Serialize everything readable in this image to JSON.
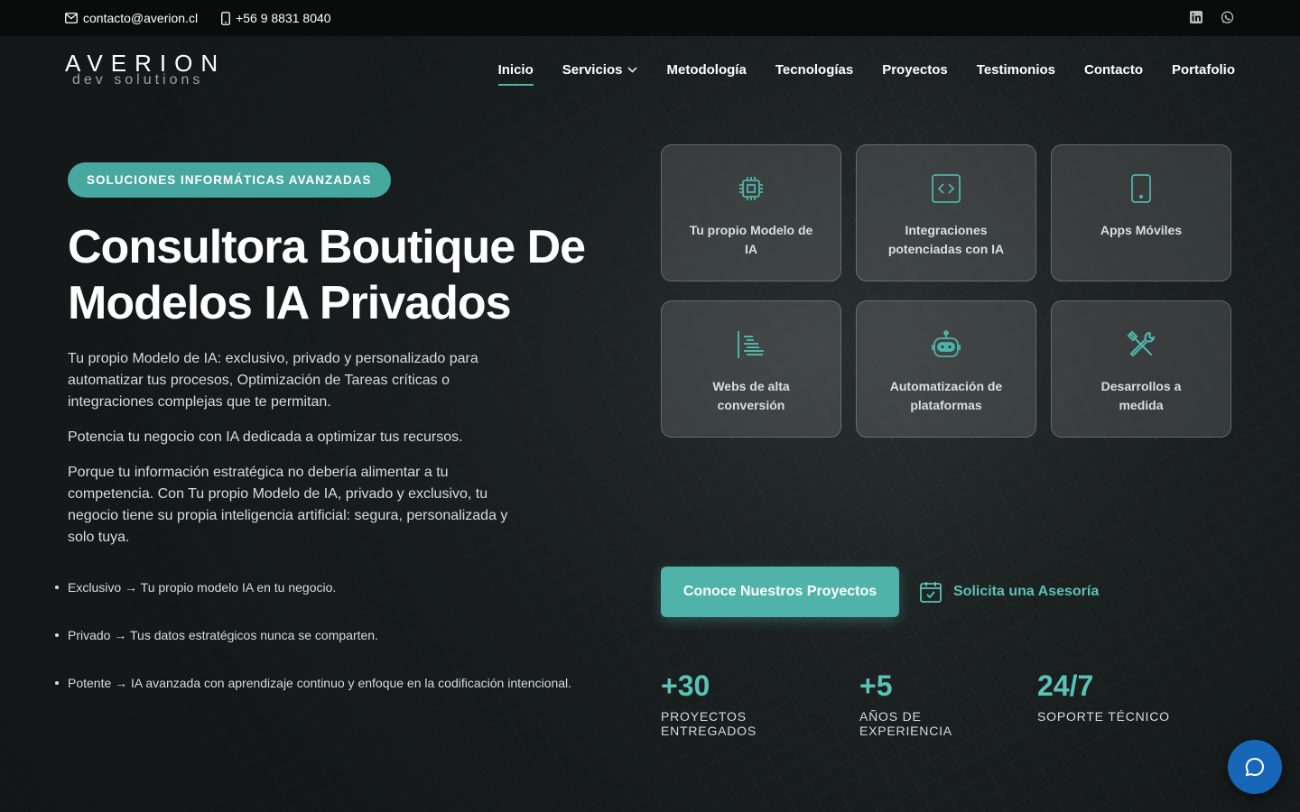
{
  "topbar": {
    "email": "contacto@averion.cl",
    "phone": "+56 9 8831 8040",
    "social": [
      "linkedin-icon",
      "whatsapp-icon"
    ]
  },
  "nav": {
    "logo_brand": "AVERION",
    "logo_sub": "dev solutions",
    "items": [
      {
        "label": "Inicio",
        "active": true
      },
      {
        "label": "Servicios",
        "dropdown": true
      },
      {
        "label": "Metodología"
      },
      {
        "label": "Tecnologías"
      },
      {
        "label": "Proyectos"
      },
      {
        "label": "Testimonios"
      },
      {
        "label": "Contacto"
      },
      {
        "label": "Portafolio"
      }
    ]
  },
  "hero": {
    "badge": "SOLUCIONES INFORMÁTICAS AVANZADAS",
    "headline": "Consultora Boutique De Modelos IA Privados",
    "paragraphs": [
      "Tu propio Modelo de IA: exclusivo, privado y personalizado para automatizar tus procesos, Optimización de Tareas críticas o integraciones complejas que te permitan.",
      "Potencia tu negocio con IA dedicada a optimizar tus recursos.",
      "Porque tu información estratégica no debería alimentar a tu competencia. Con Tu propio Modelo de IA, privado y exclusivo, tu negocio tiene su propia inteligencia artificial: segura, personalizada y solo tuya."
    ],
    "bullets": [
      "Exclusivo → Tu propio modelo IA en tu negocio.",
      "Privado → Tus datos estratégicos nunca se comparten.",
      "Potente → IA avanzada con aprendizaje continuo y enfoque en la codificación intencional."
    ]
  },
  "services": [
    {
      "label": "Tu propio Modelo de IA",
      "icon": "cpu-icon"
    },
    {
      "label": "Integraciones potenciadas con IA",
      "icon": "code-icon"
    },
    {
      "label": "Apps Móviles",
      "icon": "smartphone-icon"
    },
    {
      "label": "Webs de alta conversión",
      "icon": "list-icon"
    },
    {
      "label": "Automatización de plataformas",
      "icon": "robot-icon"
    },
    {
      "label": "Desarrollos a medida",
      "icon": "tools-icon"
    }
  ],
  "cta": {
    "primary": "Conoce Nuestros Proyectos",
    "secondary": "Solicita una Asesoría"
  },
  "stats": [
    {
      "num": "+30",
      "cap": "PROYECTOS ENTREGADOS"
    },
    {
      "num": "+5",
      "cap": "AÑOS DE EXPERIENCIA"
    },
    {
      "num": "24/7",
      "cap": "SOPORTE TÉCNICO"
    }
  ],
  "colors": {
    "accent": "#4fb3a9",
    "accent_text": "#5cc2b7",
    "chat": "#1766b7"
  }
}
